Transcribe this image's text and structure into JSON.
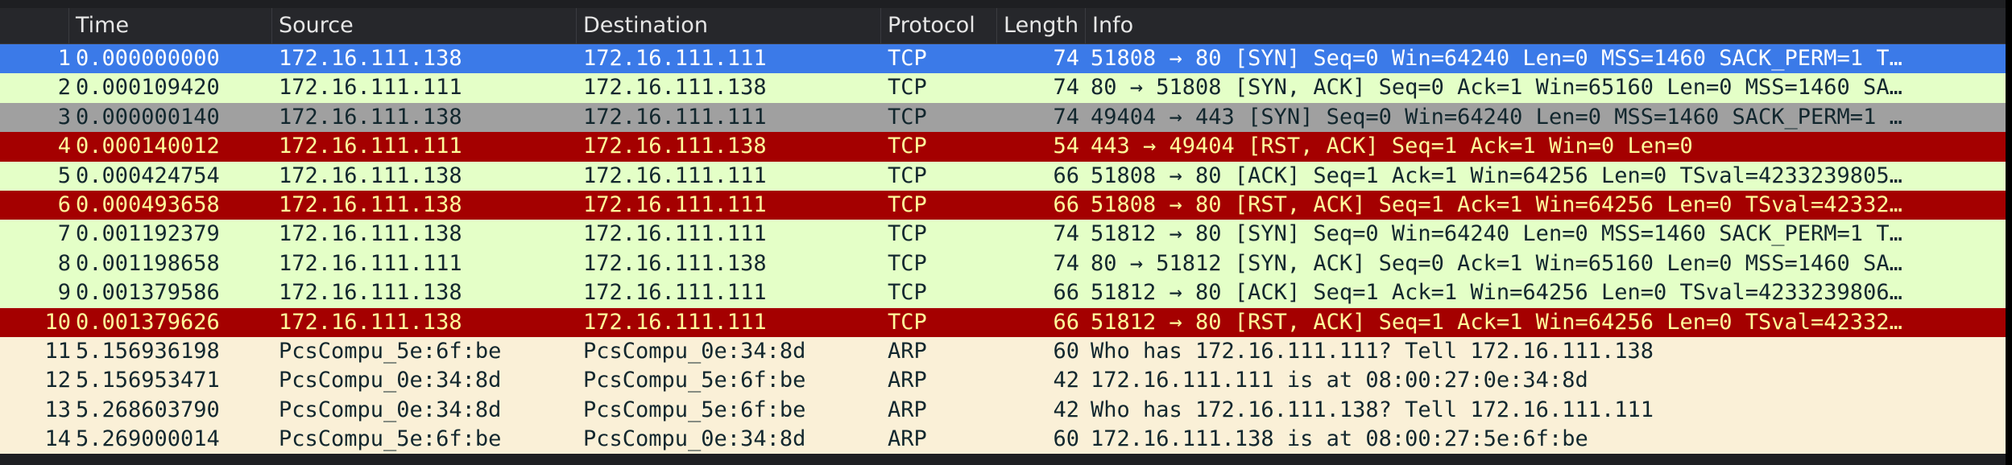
{
  "columns": {
    "no": "",
    "time": "Time",
    "source": "Source",
    "destination": "Destination",
    "protocol": "Protocol",
    "length": "Length",
    "info": "Info"
  },
  "colors": {
    "selected": "#3b7ae8",
    "tcp": "#e4ffc7",
    "tcp_bad_checksum": "#a0a0a0",
    "tcp_rst": "#a40000",
    "arp": "#faf0d7"
  },
  "packets": [
    {
      "no": "1",
      "time": "0.000000000",
      "source": "172.16.111.138",
      "destination": "172.16.111.111",
      "protocol": "TCP",
      "length": "74",
      "info": "51808 → 80 [SYN] Seq=0 Win=64240 Len=0 MSS=1460 SACK_PERM=1 T…",
      "style": "sel"
    },
    {
      "no": "2",
      "time": "0.000109420",
      "source": "172.16.111.111",
      "destination": "172.16.111.138",
      "protocol": "TCP",
      "length": "74",
      "info": "80 → 51808 [SYN, ACK] Seq=0 Ack=1 Win=65160 Len=0 MSS=1460 SA…",
      "style": "tcp"
    },
    {
      "no": "3",
      "time": "0.000000140",
      "source": "172.16.111.138",
      "destination": "172.16.111.111",
      "protocol": "TCP",
      "length": "74",
      "info": "49404 → 443 [SYN] Seq=0 Win=64240 Len=0 MSS=1460 SACK_PERM=1 …",
      "style": "gray"
    },
    {
      "no": "4",
      "time": "0.000140012",
      "source": "172.16.111.111",
      "destination": "172.16.111.138",
      "protocol": "TCP",
      "length": "54",
      "info": "443 → 49404 [RST, ACK] Seq=1 Ack=1 Win=0 Len=0",
      "style": "rst"
    },
    {
      "no": "5",
      "time": "0.000424754",
      "source": "172.16.111.138",
      "destination": "172.16.111.111",
      "protocol": "TCP",
      "length": "66",
      "info": "51808 → 80 [ACK] Seq=1 Ack=1 Win=64256 Len=0 TSval=4233239805…",
      "style": "tcp"
    },
    {
      "no": "6",
      "time": "0.000493658",
      "source": "172.16.111.138",
      "destination": "172.16.111.111",
      "protocol": "TCP",
      "length": "66",
      "info": "51808 → 80 [RST, ACK] Seq=1 Ack=1 Win=64256 Len=0 TSval=42332…",
      "style": "rst"
    },
    {
      "no": "7",
      "time": "0.001192379",
      "source": "172.16.111.138",
      "destination": "172.16.111.111",
      "protocol": "TCP",
      "length": "74",
      "info": "51812 → 80 [SYN] Seq=0 Win=64240 Len=0 MSS=1460 SACK_PERM=1 T…",
      "style": "tcp"
    },
    {
      "no": "8",
      "time": "0.001198658",
      "source": "172.16.111.111",
      "destination": "172.16.111.138",
      "protocol": "TCP",
      "length": "74",
      "info": "80 → 51812 [SYN, ACK] Seq=0 Ack=1 Win=65160 Len=0 MSS=1460 SA…",
      "style": "tcp"
    },
    {
      "no": "9",
      "time": "0.001379586",
      "source": "172.16.111.138",
      "destination": "172.16.111.111",
      "protocol": "TCP",
      "length": "66",
      "info": "51812 → 80 [ACK] Seq=1 Ack=1 Win=64256 Len=0 TSval=4233239806…",
      "style": "tcp"
    },
    {
      "no": "10",
      "time": "0.001379626",
      "source": "172.16.111.138",
      "destination": "172.16.111.111",
      "protocol": "TCP",
      "length": "66",
      "info": "51812 → 80 [RST, ACK] Seq=1 Ack=1 Win=64256 Len=0 TSval=42332…",
      "style": "rst"
    },
    {
      "no": "11",
      "time": "5.156936198",
      "source": "PcsCompu_5e:6f:be",
      "destination": "PcsCompu_0e:34:8d",
      "protocol": "ARP",
      "length": "60",
      "info": "Who has 172.16.111.111? Tell 172.16.111.138",
      "style": "arp"
    },
    {
      "no": "12",
      "time": "5.156953471",
      "source": "PcsCompu_0e:34:8d",
      "destination": "PcsCompu_5e:6f:be",
      "protocol": "ARP",
      "length": "42",
      "info": "172.16.111.111 is at 08:00:27:0e:34:8d",
      "style": "arp"
    },
    {
      "no": "13",
      "time": "5.268603790",
      "source": "PcsCompu_0e:34:8d",
      "destination": "PcsCompu_5e:6f:be",
      "protocol": "ARP",
      "length": "42",
      "info": "Who has 172.16.111.138? Tell 172.16.111.111",
      "style": "arp"
    },
    {
      "no": "14",
      "time": "5.269000014",
      "source": "PcsCompu_5e:6f:be",
      "destination": "PcsCompu_0e:34:8d",
      "protocol": "ARP",
      "length": "60",
      "info": "172.16.111.138 is at 08:00:27:5e:6f:be",
      "style": "arp"
    }
  ]
}
